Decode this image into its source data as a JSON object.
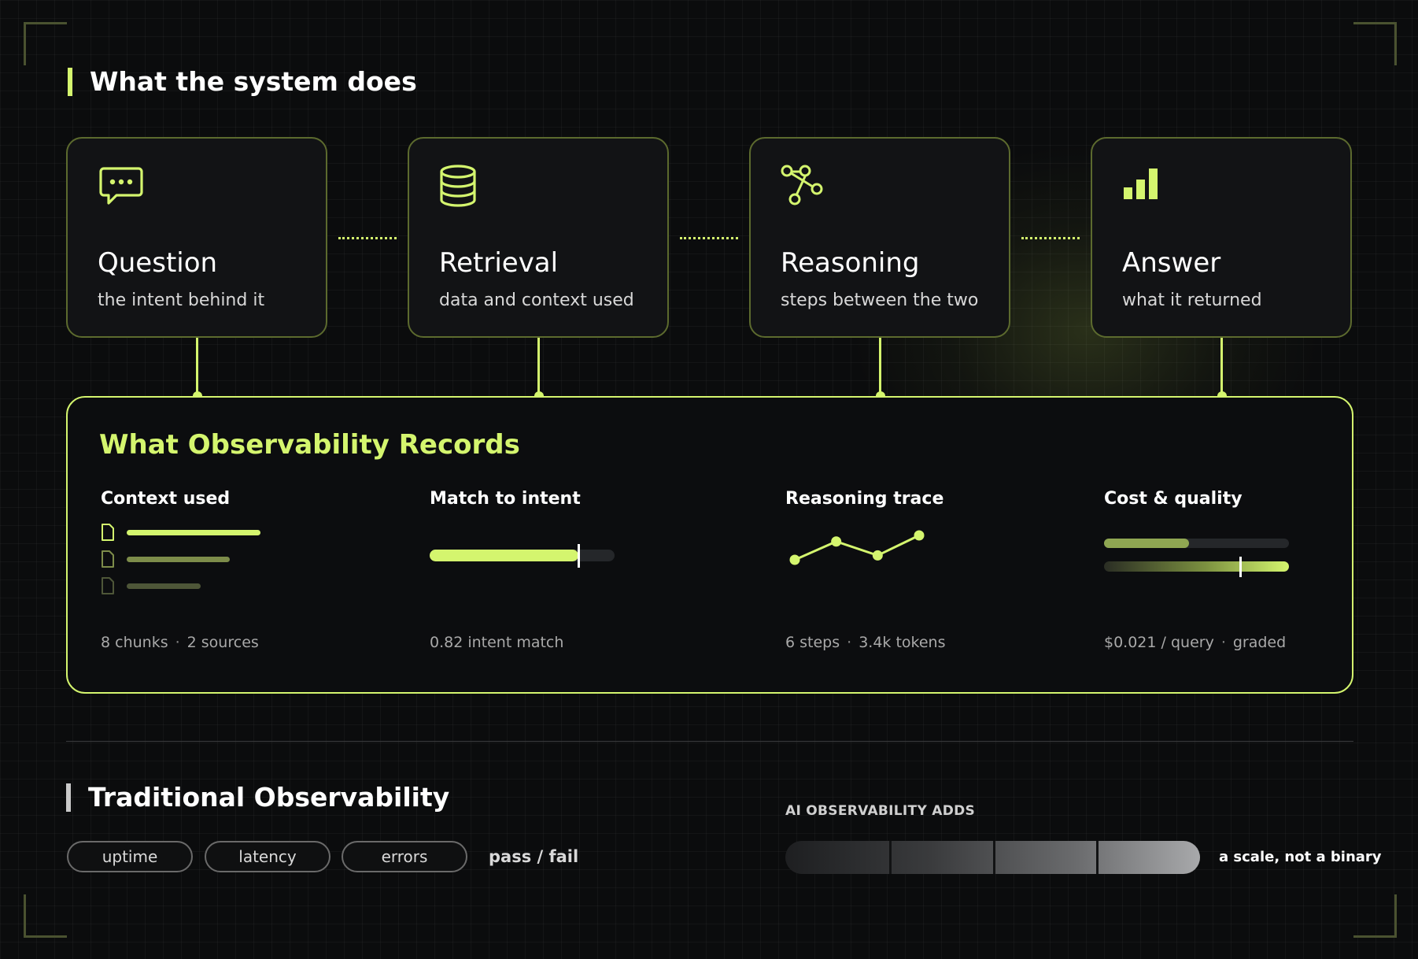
{
  "system_section": {
    "title": "What the system does"
  },
  "stages": [
    {
      "name": "Question",
      "subtitle": "the intent behind it",
      "icon": "chat-bubble-icon"
    },
    {
      "name": "Retrieval",
      "subtitle": "data and context used",
      "icon": "database-icon"
    },
    {
      "name": "Reasoning",
      "subtitle": "steps between the two",
      "icon": "graph-nodes-icon"
    },
    {
      "name": "Answer",
      "subtitle": "what it returned",
      "icon": "bar-chart-icon"
    }
  ],
  "records": {
    "title": "What Observability Records",
    "context": {
      "label": "Context used",
      "chunks": "8 chunks",
      "sources": "2 sources",
      "doc_bars": [
        1.0,
        0.77,
        0.55
      ]
    },
    "match": {
      "label": "Match to intent",
      "value_text": "0.82 intent match",
      "value": 0.82
    },
    "reasoning": {
      "label": "Reasoning trace",
      "steps": "6 steps",
      "tokens": "3.4k tokens",
      "trace": [
        0.0,
        0.75,
        0.18,
        1.0
      ]
    },
    "cost": {
      "label": "Cost & quality",
      "cost": "$0.021 / query",
      "graded": "graded",
      "cost_fill": 0.46,
      "quality_marker": 0.73
    }
  },
  "traditional": {
    "title": "Traditional Observability",
    "pills": [
      "uptime",
      "latency",
      "errors"
    ],
    "result": "pass / fail"
  },
  "ai_adds": {
    "label": "AI OBSERVABILITY ADDS",
    "caption": "a scale, not a binary",
    "segments": 4
  },
  "colors": {
    "accent": "#d4f56e",
    "background": "#0b0c0d",
    "card_border": "#5c6a2e"
  }
}
